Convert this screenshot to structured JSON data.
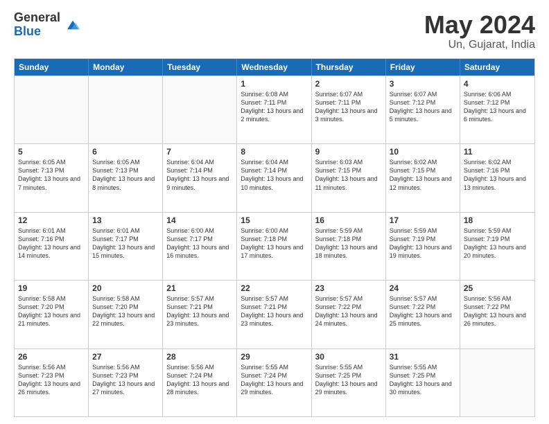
{
  "logo": {
    "general": "General",
    "blue": "Blue"
  },
  "title": "May 2024",
  "subtitle": "Un, Gujarat, India",
  "header_days": [
    "Sunday",
    "Monday",
    "Tuesday",
    "Wednesday",
    "Thursday",
    "Friday",
    "Saturday"
  ],
  "weeks": [
    [
      {
        "day": "",
        "sunrise": "",
        "sunset": "",
        "daylight": ""
      },
      {
        "day": "",
        "sunrise": "",
        "sunset": "",
        "daylight": ""
      },
      {
        "day": "",
        "sunrise": "",
        "sunset": "",
        "daylight": ""
      },
      {
        "day": "1",
        "sunrise": "Sunrise: 6:08 AM",
        "sunset": "Sunset: 7:11 PM",
        "daylight": "Daylight: 13 hours and 2 minutes."
      },
      {
        "day": "2",
        "sunrise": "Sunrise: 6:07 AM",
        "sunset": "Sunset: 7:11 PM",
        "daylight": "Daylight: 13 hours and 3 minutes."
      },
      {
        "day": "3",
        "sunrise": "Sunrise: 6:07 AM",
        "sunset": "Sunset: 7:12 PM",
        "daylight": "Daylight: 13 hours and 5 minutes."
      },
      {
        "day": "4",
        "sunrise": "Sunrise: 6:06 AM",
        "sunset": "Sunset: 7:12 PM",
        "daylight": "Daylight: 13 hours and 6 minutes."
      }
    ],
    [
      {
        "day": "5",
        "sunrise": "Sunrise: 6:05 AM",
        "sunset": "Sunset: 7:13 PM",
        "daylight": "Daylight: 13 hours and 7 minutes."
      },
      {
        "day": "6",
        "sunrise": "Sunrise: 6:05 AM",
        "sunset": "Sunset: 7:13 PM",
        "daylight": "Daylight: 13 hours and 8 minutes."
      },
      {
        "day": "7",
        "sunrise": "Sunrise: 6:04 AM",
        "sunset": "Sunset: 7:14 PM",
        "daylight": "Daylight: 13 hours and 9 minutes."
      },
      {
        "day": "8",
        "sunrise": "Sunrise: 6:04 AM",
        "sunset": "Sunset: 7:14 PM",
        "daylight": "Daylight: 13 hours and 10 minutes."
      },
      {
        "day": "9",
        "sunrise": "Sunrise: 6:03 AM",
        "sunset": "Sunset: 7:15 PM",
        "daylight": "Daylight: 13 hours and 11 minutes."
      },
      {
        "day": "10",
        "sunrise": "Sunrise: 6:02 AM",
        "sunset": "Sunset: 7:15 PM",
        "daylight": "Daylight: 13 hours and 12 minutes."
      },
      {
        "day": "11",
        "sunrise": "Sunrise: 6:02 AM",
        "sunset": "Sunset: 7:16 PM",
        "daylight": "Daylight: 13 hours and 13 minutes."
      }
    ],
    [
      {
        "day": "12",
        "sunrise": "Sunrise: 6:01 AM",
        "sunset": "Sunset: 7:16 PM",
        "daylight": "Daylight: 13 hours and 14 minutes."
      },
      {
        "day": "13",
        "sunrise": "Sunrise: 6:01 AM",
        "sunset": "Sunset: 7:17 PM",
        "daylight": "Daylight: 13 hours and 15 minutes."
      },
      {
        "day": "14",
        "sunrise": "Sunrise: 6:00 AM",
        "sunset": "Sunset: 7:17 PM",
        "daylight": "Daylight: 13 hours and 16 minutes."
      },
      {
        "day": "15",
        "sunrise": "Sunrise: 6:00 AM",
        "sunset": "Sunset: 7:18 PM",
        "daylight": "Daylight: 13 hours and 17 minutes."
      },
      {
        "day": "16",
        "sunrise": "Sunrise: 5:59 AM",
        "sunset": "Sunset: 7:18 PM",
        "daylight": "Daylight: 13 hours and 18 minutes."
      },
      {
        "day": "17",
        "sunrise": "Sunrise: 5:59 AM",
        "sunset": "Sunset: 7:19 PM",
        "daylight": "Daylight: 13 hours and 19 minutes."
      },
      {
        "day": "18",
        "sunrise": "Sunrise: 5:59 AM",
        "sunset": "Sunset: 7:19 PM",
        "daylight": "Daylight: 13 hours and 20 minutes."
      }
    ],
    [
      {
        "day": "19",
        "sunrise": "Sunrise: 5:58 AM",
        "sunset": "Sunset: 7:20 PM",
        "daylight": "Daylight: 13 hours and 21 minutes."
      },
      {
        "day": "20",
        "sunrise": "Sunrise: 5:58 AM",
        "sunset": "Sunset: 7:20 PM",
        "daylight": "Daylight: 13 hours and 22 minutes."
      },
      {
        "day": "21",
        "sunrise": "Sunrise: 5:57 AM",
        "sunset": "Sunset: 7:21 PM",
        "daylight": "Daylight: 13 hours and 23 minutes."
      },
      {
        "day": "22",
        "sunrise": "Sunrise: 5:57 AM",
        "sunset": "Sunset: 7:21 PM",
        "daylight": "Daylight: 13 hours and 23 minutes."
      },
      {
        "day": "23",
        "sunrise": "Sunrise: 5:57 AM",
        "sunset": "Sunset: 7:22 PM",
        "daylight": "Daylight: 13 hours and 24 minutes."
      },
      {
        "day": "24",
        "sunrise": "Sunrise: 5:57 AM",
        "sunset": "Sunset: 7:22 PM",
        "daylight": "Daylight: 13 hours and 25 minutes."
      },
      {
        "day": "25",
        "sunrise": "Sunrise: 5:56 AM",
        "sunset": "Sunset: 7:22 PM",
        "daylight": "Daylight: 13 hours and 26 minutes."
      }
    ],
    [
      {
        "day": "26",
        "sunrise": "Sunrise: 5:56 AM",
        "sunset": "Sunset: 7:23 PM",
        "daylight": "Daylight: 13 hours and 26 minutes."
      },
      {
        "day": "27",
        "sunrise": "Sunrise: 5:56 AM",
        "sunset": "Sunset: 7:23 PM",
        "daylight": "Daylight: 13 hours and 27 minutes."
      },
      {
        "day": "28",
        "sunrise": "Sunrise: 5:56 AM",
        "sunset": "Sunset: 7:24 PM",
        "daylight": "Daylight: 13 hours and 28 minutes."
      },
      {
        "day": "29",
        "sunrise": "Sunrise: 5:55 AM",
        "sunset": "Sunset: 7:24 PM",
        "daylight": "Daylight: 13 hours and 29 minutes."
      },
      {
        "day": "30",
        "sunrise": "Sunrise: 5:55 AM",
        "sunset": "Sunset: 7:25 PM",
        "daylight": "Daylight: 13 hours and 29 minutes."
      },
      {
        "day": "31",
        "sunrise": "Sunrise: 5:55 AM",
        "sunset": "Sunset: 7:25 PM",
        "daylight": "Daylight: 13 hours and 30 minutes."
      },
      {
        "day": "",
        "sunrise": "",
        "sunset": "",
        "daylight": ""
      }
    ]
  ]
}
